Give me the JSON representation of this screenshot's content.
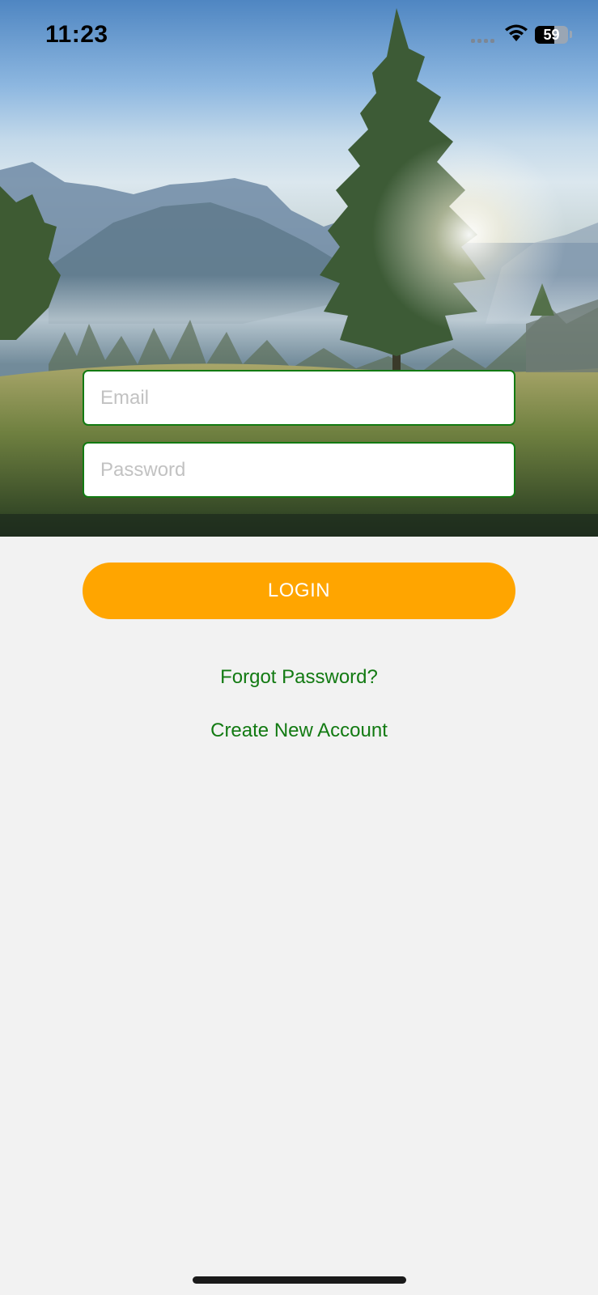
{
  "status_bar": {
    "time": "11:23",
    "battery_percent": "59",
    "battery_level": 0.59
  },
  "login_form": {
    "email_placeholder": "Email",
    "password_placeholder": "Password",
    "login_label": "LOGIN",
    "forgot_password_label": "Forgot Password?",
    "create_account_label": "Create New Account"
  },
  "colors": {
    "accent_orange": "#ffa500",
    "link_green": "#127a12",
    "field_border": "#127a12",
    "background": "#f2f2f2"
  },
  "icons": [
    "cellular-signal-icon",
    "wifi-icon",
    "battery-icon"
  ]
}
